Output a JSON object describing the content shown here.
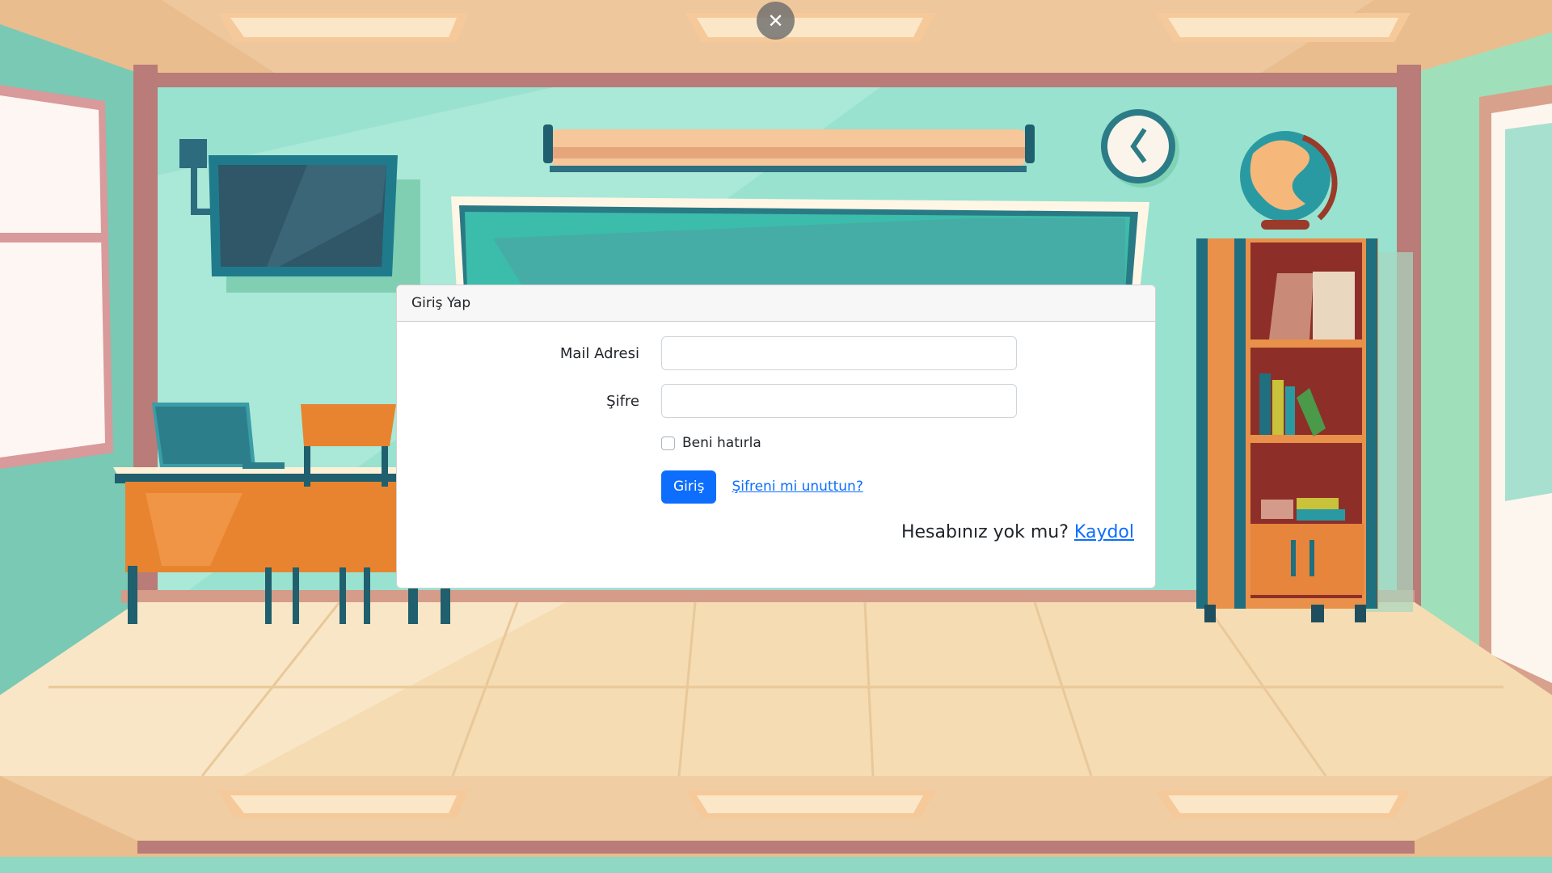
{
  "close_button": {
    "symbol": "✕"
  },
  "login_card": {
    "title": "Giriş Yap",
    "email_label": "Mail Adresi",
    "email_value": "",
    "password_label": "Şifre",
    "password_value": "",
    "remember_label": "Beni hatırla",
    "remember_checked": false,
    "submit_label": "Giriş",
    "forgot_link": "Şifreni mi unuttun?",
    "signup_prompt": "Hesabınız yok mu?",
    "signup_link": "Kaydol"
  },
  "colors": {
    "primary": "#0d6efd",
    "wall": "#98e2cf",
    "floor": "#f5dcb3",
    "ceiling": "#e9bd8e"
  }
}
